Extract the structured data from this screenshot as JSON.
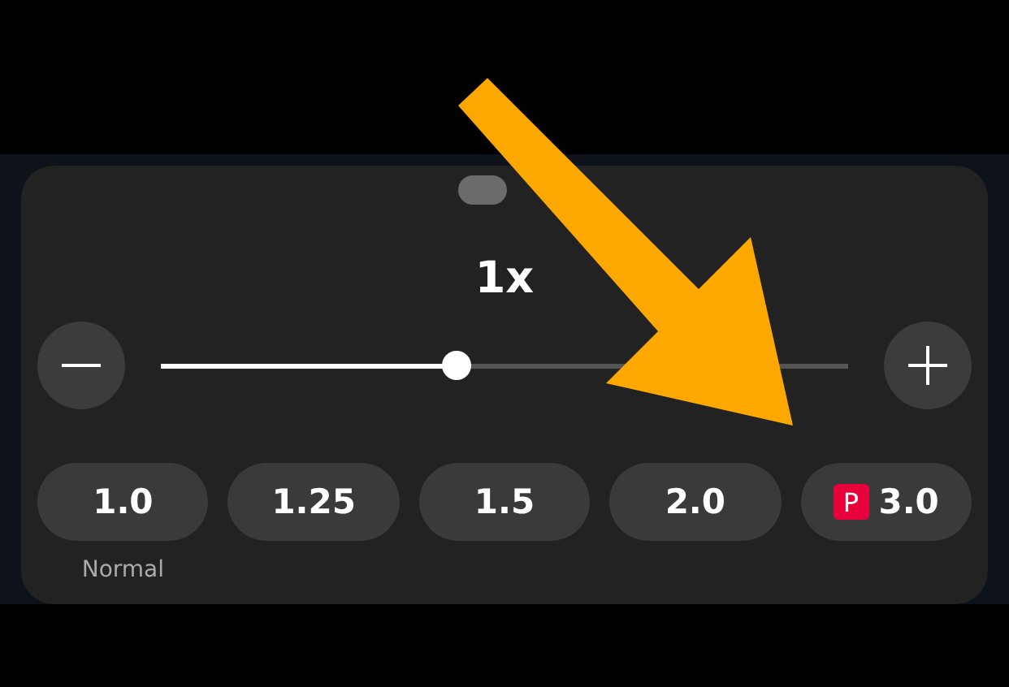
{
  "speed": {
    "title": "1x",
    "level": 0.43
  },
  "presets": [
    {
      "label": "1.0",
      "caption": "Normal"
    },
    {
      "label": "1.25"
    },
    {
      "label": "1.5"
    },
    {
      "label": "2.0"
    },
    {
      "label": "3.0",
      "badge": "P"
    }
  ]
}
